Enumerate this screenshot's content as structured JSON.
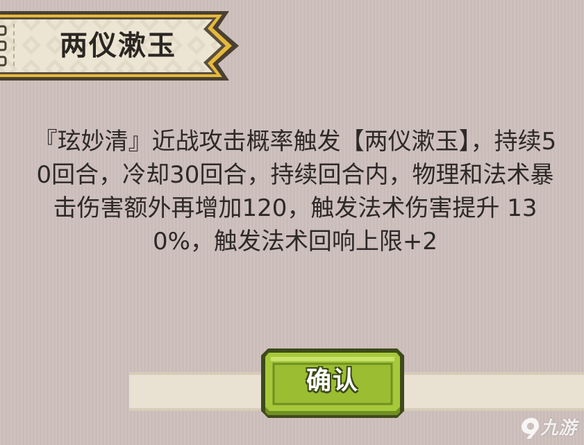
{
  "dialog": {
    "title": "两仪漱玉",
    "description": "『玹妙清』近战攻击概率触发【两仪漱玉】，持续50回合，冷却30回合，持续回合内，物理和法术暴击伤害额外再增加120，触发法术伤害提升 130%，触发法术回响上限+2",
    "confirm_label": "确认"
  },
  "watermark": {
    "text": "九游"
  },
  "colors": {
    "background": "#cdbfbc",
    "banner_fill": "#ece5d4",
    "banner_border": "#4a4032",
    "banner_trim": "#e6b93c",
    "button_green": "#a6c93a",
    "button_border": "#4b5a1e",
    "text": "#2d2926"
  }
}
